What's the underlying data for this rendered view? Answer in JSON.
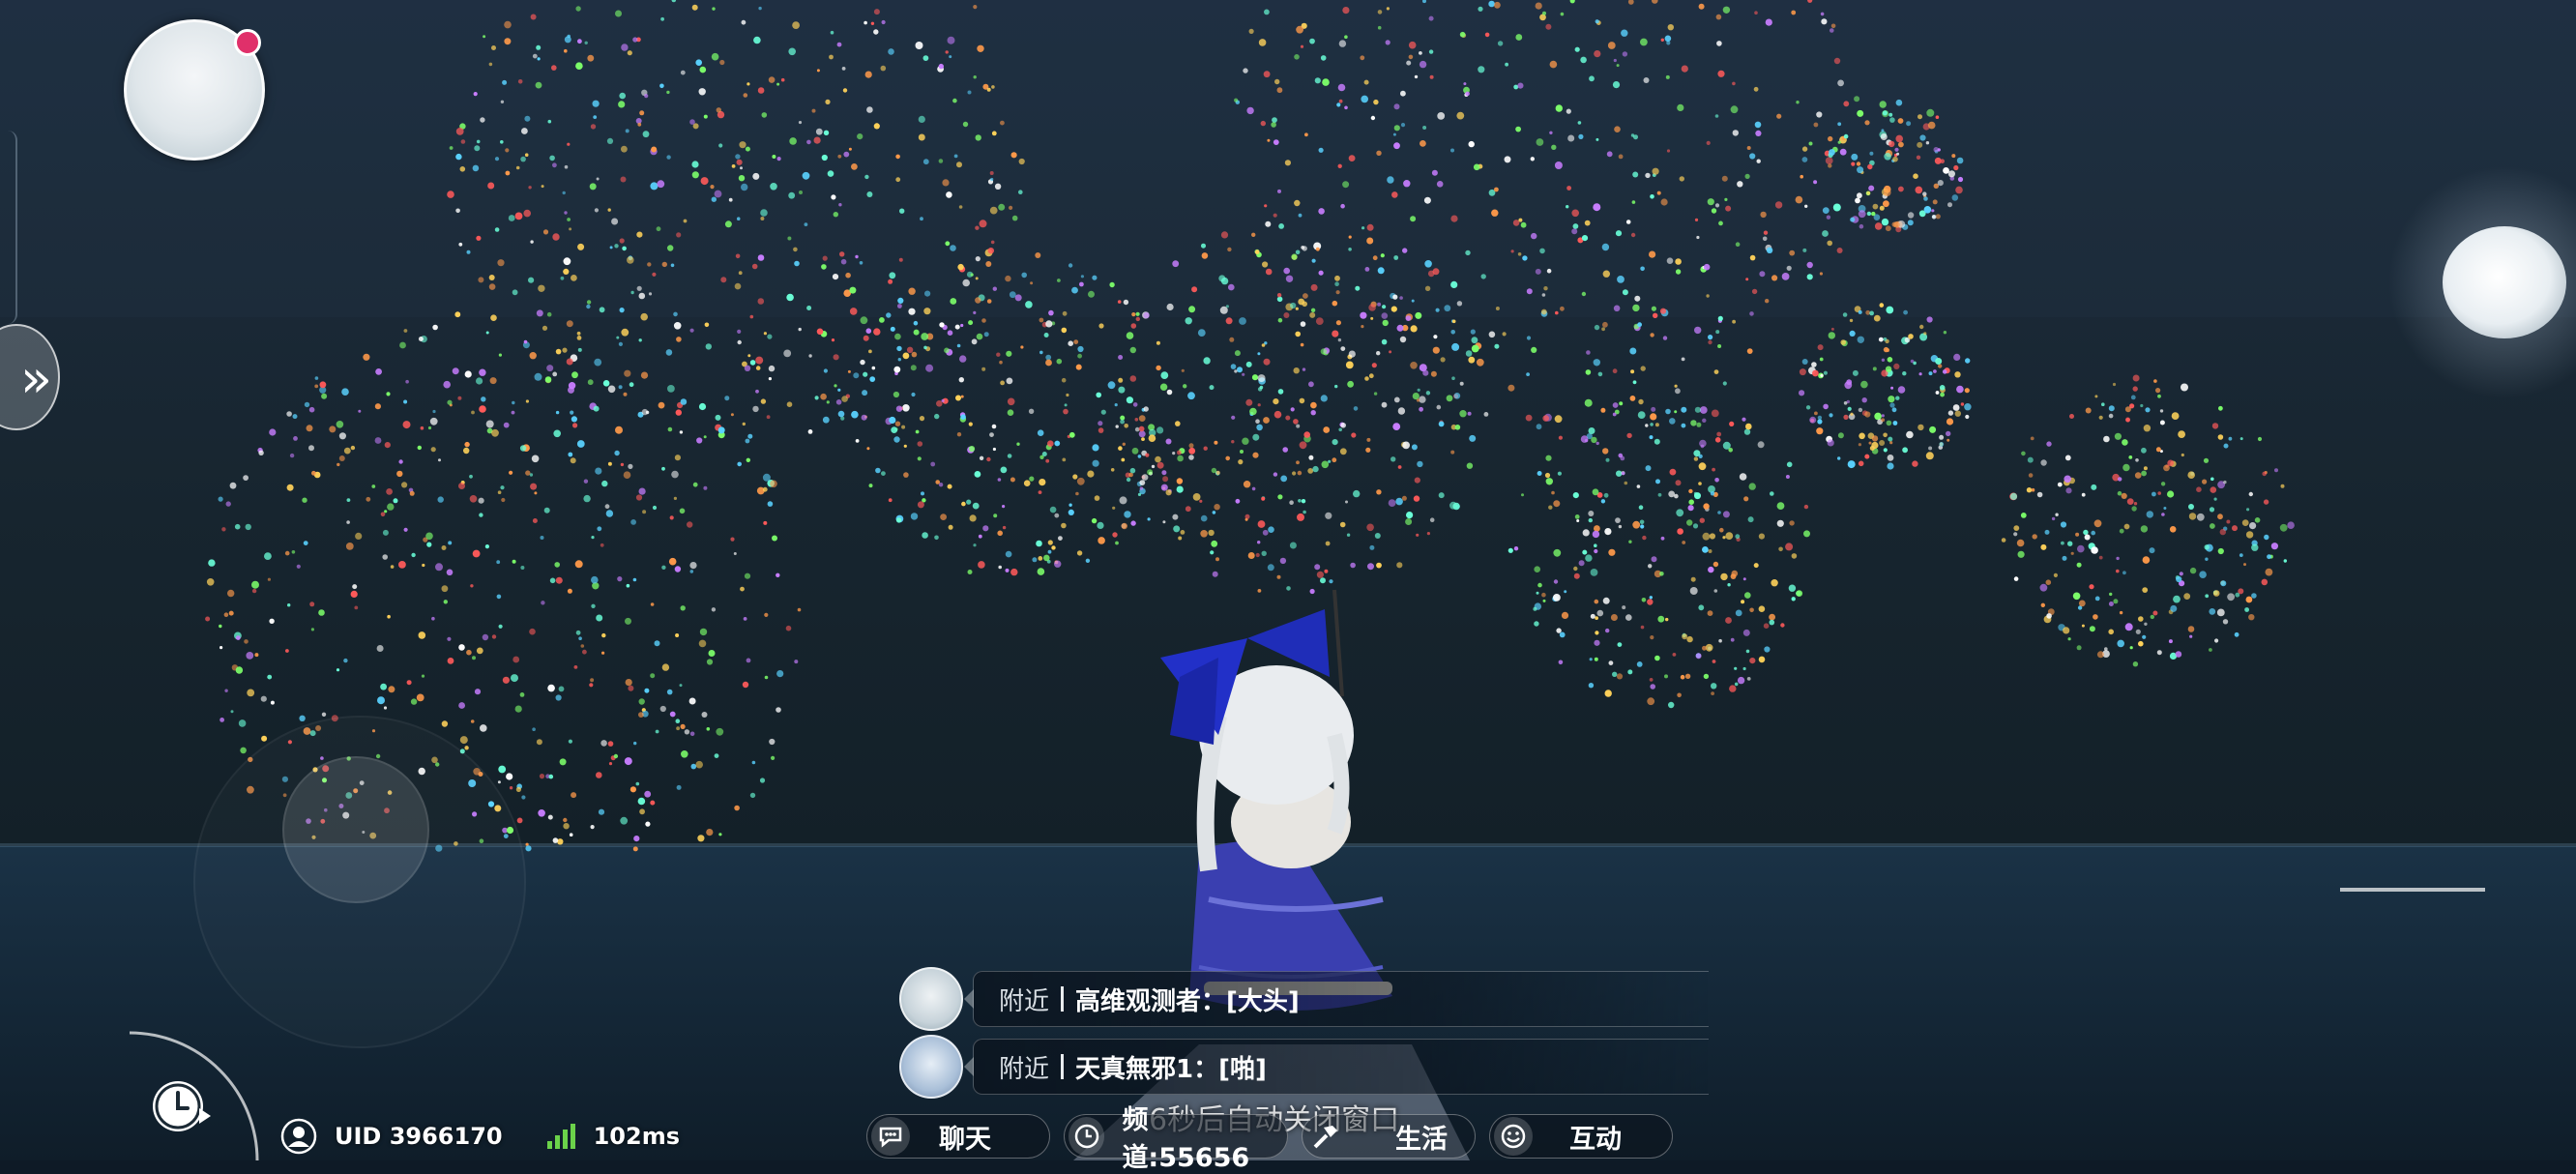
{
  "colors": {
    "sky_top": "#1c2b3d",
    "sky_bottom": "#16232f",
    "sea": "#142637",
    "accent_dot": "#e0306a",
    "signal": "#6bd24a"
  },
  "hud": {
    "profile_avatar_icon": "player-portrait",
    "side_toggle_icon": "double-chevron-right-icon",
    "clock_icon": "clock-icon"
  },
  "status": {
    "uid": "UID 3966170",
    "ping": "102ms",
    "user_icon": "user-icon",
    "signal_icon": "signal-bars-icon"
  },
  "chat": {
    "messages": [
      {
        "channel": "附近",
        "name": "高维观测者",
        "text": "高维观测者：[大头]"
      },
      {
        "channel": "附近",
        "name": "天真無邪1",
        "text": "天真無邪1：[啪]"
      }
    ],
    "close_hint": "6秒后自动关闭窗口"
  },
  "bottom_bar": {
    "items": [
      {
        "label": "聊天",
        "icon": "chat-bubble-icon"
      },
      {
        "label": "频道:55656",
        "icon": "clock-icon"
      },
      {
        "label": "生活",
        "icon": "hammer-icon"
      },
      {
        "label": "互动",
        "icon": "smile-icon"
      }
    ]
  }
}
